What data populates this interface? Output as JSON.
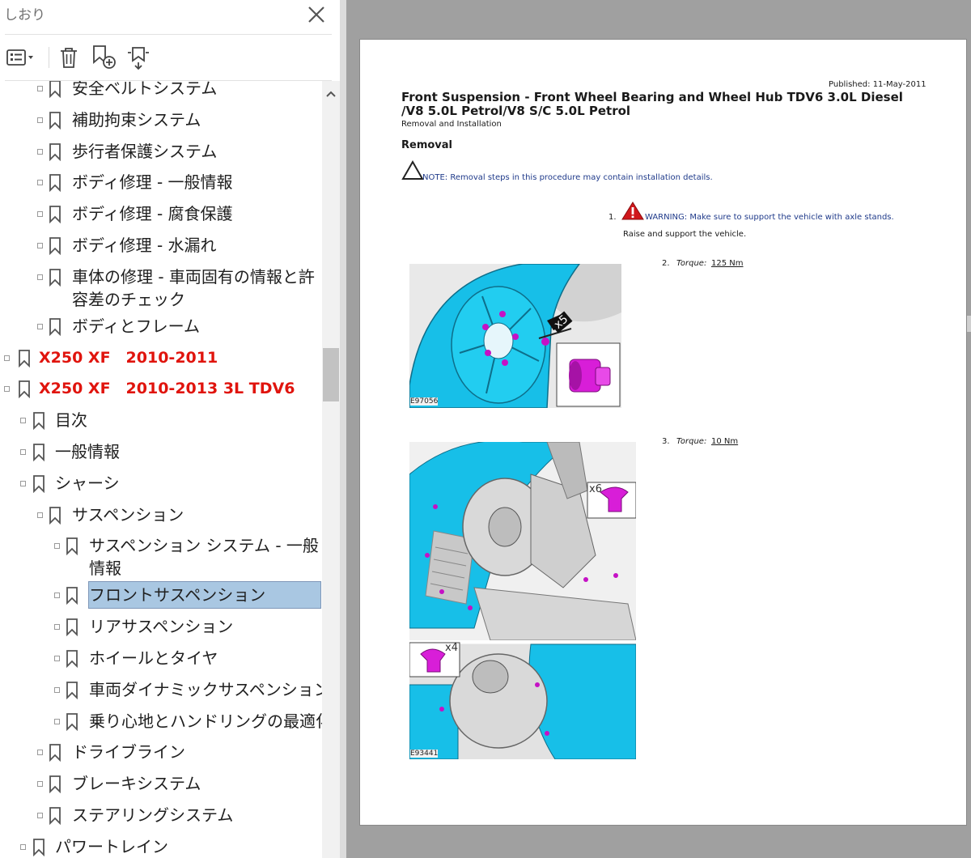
{
  "bookmarks_panel": {
    "title": "しおり",
    "items": [
      {
        "label": "安全ベルトシステム",
        "level": 2
      },
      {
        "label": "補助拘束システム",
        "level": 2
      },
      {
        "label": "歩行者保護システム",
        "level": 2
      },
      {
        "label": "ボディ修理 - 一般情報",
        "level": 2
      },
      {
        "label": "ボディ修理 - 腐食保護",
        "level": 2
      },
      {
        "label": "ボディ修理 - 水漏れ",
        "level": 2
      },
      {
        "label": "車体の修理 - 車両固有の情報と許容差のチェック",
        "level": 2
      },
      {
        "label": "ボディとフレーム",
        "level": 2
      },
      {
        "label": "X250 XF　2010-2011",
        "level": 0
      },
      {
        "label": "X250 XF　2010-2013 3L TDV6",
        "level": 0
      },
      {
        "label": "目次",
        "level": 1
      },
      {
        "label": "一般情報",
        "level": 1
      },
      {
        "label": "シャーシ",
        "level": 1
      },
      {
        "label": "サスペンション",
        "level": 2
      },
      {
        "label": "サスペンション システム - 一般情報",
        "level": 3
      },
      {
        "label": "フロントサスペンション",
        "level": 3,
        "selected": true
      },
      {
        "label": "リアサスペンション",
        "level": 3
      },
      {
        "label": "ホイールとタイヤ",
        "level": 3
      },
      {
        "label": "車両ダイナミックサスペンション",
        "level": 3
      },
      {
        "label": "乗り心地とハンドリングの最適化",
        "level": 3
      },
      {
        "label": "ドライブライン",
        "level": 2
      },
      {
        "label": "ブレーキシステム",
        "level": 2
      },
      {
        "label": "ステアリングシステム",
        "level": 2
      },
      {
        "label": "パワートレイン",
        "level": 1
      }
    ]
  },
  "document": {
    "published": "Published: 11-May-2011",
    "title": "Front Suspension - Front Wheel Bearing and Wheel Hub TDV6 3.0L Diesel /V8 5.0L Petrol/V8 S/C 5.0L Petrol",
    "subtitle": "Removal and Installation",
    "section_heading": "Removal",
    "note": "NOTE: Removal steps in this procedure may contain installation details.",
    "step1": {
      "num": "1.",
      "warning": "WARNING: Make sure to support the vehicle with axle stands.",
      "text": "Raise and support the vehicle."
    },
    "step2": {
      "num": "2.",
      "label": "Torque:",
      "value": "125 Nm"
    },
    "step3": {
      "num": "3.",
      "label": "Torque:",
      "value": "10 Nm"
    },
    "figures": {
      "fig1": {
        "code": "E97056",
        "count": "x5"
      },
      "fig2": {
        "code": "E93441",
        "count_a": "x6",
        "count_b": "x4"
      }
    }
  },
  "colors": {
    "accent_red": "#e0140d",
    "selection": "#a9c7e2",
    "part_cyan": "#1ec8ee",
    "part_magenta": "#e21ee2"
  }
}
